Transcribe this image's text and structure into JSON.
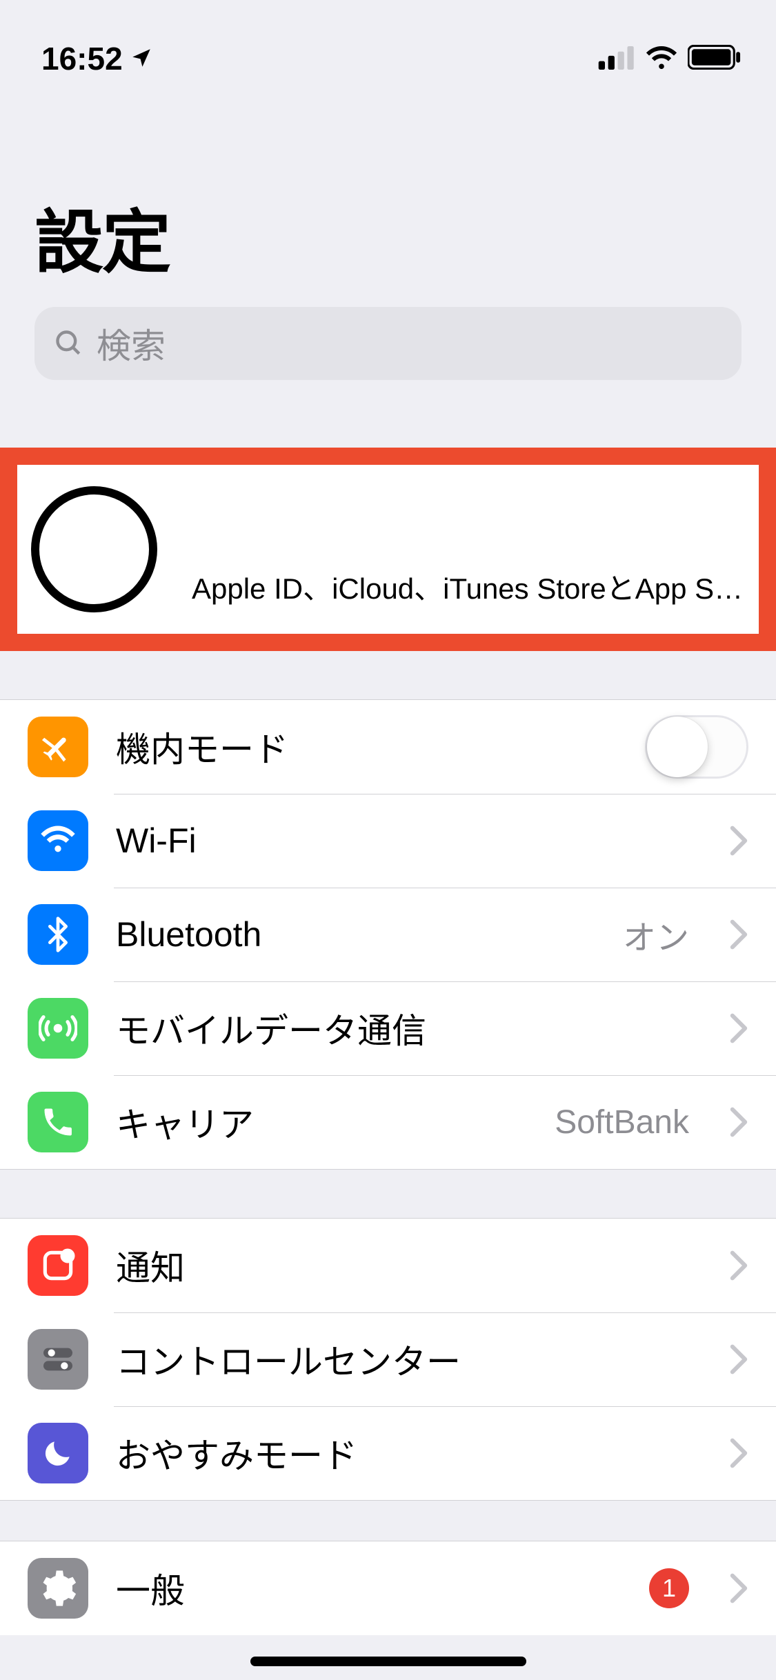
{
  "status": {
    "time": "16:52",
    "location_icon": "location-arrow"
  },
  "header": {
    "title": "設定"
  },
  "search": {
    "placeholder": "検索"
  },
  "appleid": {
    "subtitle": "Apple ID、iCloud、iTunes StoreとApp S…"
  },
  "groups": [
    {
      "rows": [
        {
          "id": "airplane",
          "icon": "airplane-icon",
          "icon_bg": "bg-orange",
          "label": "機内モード",
          "control": "toggle",
          "toggle": false
        },
        {
          "id": "wifi",
          "icon": "wifi-icon",
          "icon_bg": "bg-blue",
          "label": "Wi-Fi",
          "control": "disclosure"
        },
        {
          "id": "bluetooth",
          "icon": "bluetooth-icon",
          "icon_bg": "bg-blue",
          "label": "Bluetooth",
          "value": "オン",
          "control": "disclosure"
        },
        {
          "id": "cellular",
          "icon": "cellular-icon",
          "icon_bg": "bg-green",
          "label": "モバイルデータ通信",
          "control": "disclosure"
        },
        {
          "id": "carrier",
          "icon": "phone-icon",
          "icon_bg": "bg-green",
          "label": "キャリア",
          "value": "SoftBank",
          "control": "disclosure"
        }
      ]
    },
    {
      "rows": [
        {
          "id": "notifications",
          "icon": "notifications-icon",
          "icon_bg": "bg-red",
          "label": "通知",
          "control": "disclosure"
        },
        {
          "id": "controlcenter",
          "icon": "controlcenter-icon",
          "icon_bg": "bg-grey",
          "label": "コントロールセンター",
          "control": "disclosure"
        },
        {
          "id": "dnd",
          "icon": "moon-icon",
          "icon_bg": "bg-purple",
          "label": "おやすみモード",
          "control": "disclosure"
        }
      ]
    },
    {
      "rows": [
        {
          "id": "general",
          "icon": "gear-icon",
          "icon_bg": "bg-grey",
          "label": "一般",
          "badge": "1",
          "control": "disclosure"
        }
      ]
    }
  ]
}
